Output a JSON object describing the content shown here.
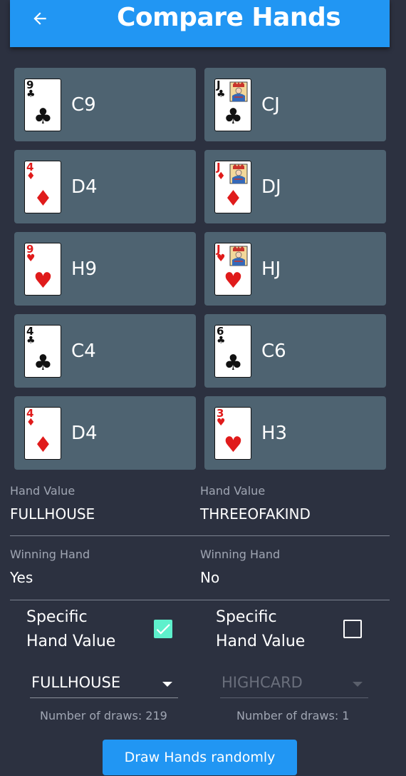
{
  "appbar": {
    "title": "Compare Hands",
    "back_icon": "arrow-left-icon",
    "color": "#2196f3"
  },
  "hands": [
    {
      "cards": [
        {
          "code": "C9",
          "rank": "9",
          "suit": "♣",
          "color": "black",
          "face": false
        },
        {
          "code": "D4",
          "rank": "4",
          "suit": "♦",
          "color": "red",
          "face": false
        },
        {
          "code": "H9",
          "rank": "9",
          "suit": "♥",
          "color": "red",
          "face": false
        },
        {
          "code": "C4",
          "rank": "4",
          "suit": "♣",
          "color": "black",
          "face": false
        },
        {
          "code": "D4",
          "rank": "4",
          "suit": "♦",
          "color": "red",
          "face": false
        }
      ],
      "hand_value_label": "Hand Value",
      "hand_value": "FULLHOUSE",
      "winning_label": "Winning Hand",
      "winning": "Yes",
      "specific_label_line1": "Specific",
      "specific_label_line2": "Hand Value",
      "specific_checked": true,
      "dropdown_value": "FULLHOUSE",
      "dropdown_enabled": true,
      "draws_text": "Number of draws: 219"
    },
    {
      "cards": [
        {
          "code": "CJ",
          "rank": "J",
          "suit": "♣",
          "color": "black",
          "face": true
        },
        {
          "code": "DJ",
          "rank": "J",
          "suit": "♦",
          "color": "red",
          "face": true
        },
        {
          "code": "HJ",
          "rank": "J",
          "suit": "♥",
          "color": "red",
          "face": true
        },
        {
          "code": "C6",
          "rank": "6",
          "suit": "♣",
          "color": "black",
          "face": false
        },
        {
          "code": "H3",
          "rank": "3",
          "suit": "♥",
          "color": "red",
          "face": false
        }
      ],
      "hand_value_label": "Hand Value",
      "hand_value": "THREEOFAKIND",
      "winning_label": "Winning Hand",
      "winning": "No",
      "specific_label_line1": "Specific",
      "specific_label_line2": "Hand Value",
      "specific_checked": false,
      "dropdown_value": "HIGHCARD",
      "dropdown_enabled": false,
      "draws_text": "Number of draws: 1"
    }
  ],
  "draw_button_label": "Draw Hands randomly",
  "colors": {
    "background": "#2c3140",
    "tile": "#4e6371",
    "accent": "#2196f3",
    "checkbox_checked": "#5ef0cc",
    "red_suit": "#e01b1b"
  }
}
